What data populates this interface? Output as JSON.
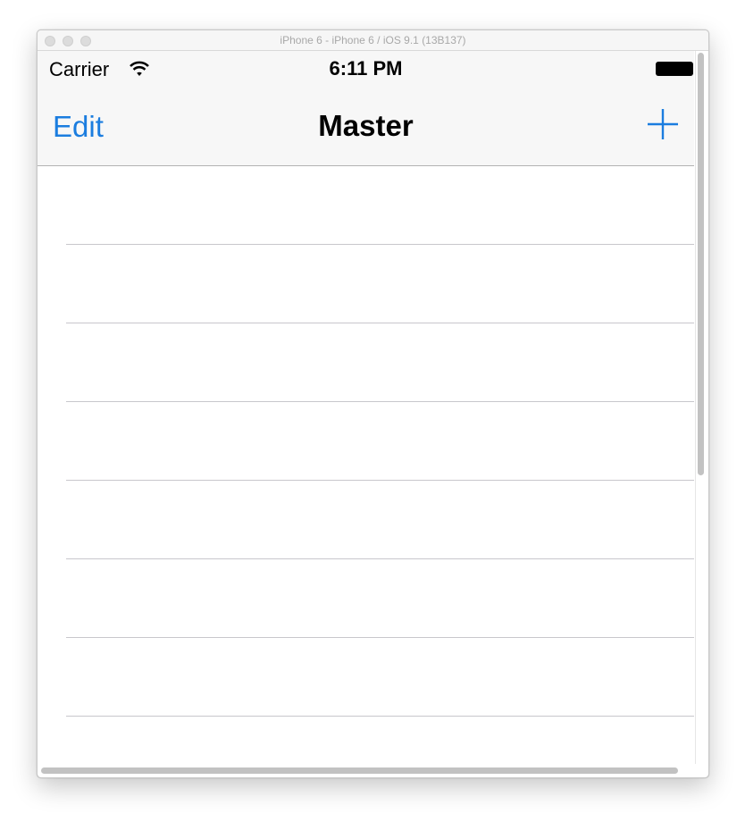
{
  "window": {
    "title": "iPhone 6 - iPhone 6 / iOS 9.1 (13B137)"
  },
  "statusbar": {
    "carrier": "Carrier",
    "time": "6:11 PM",
    "wifi_icon": "wifi-icon",
    "battery_icon": "battery-icon"
  },
  "navbar": {
    "edit_label": "Edit",
    "title": "Master",
    "add_icon": "plus-icon"
  },
  "table": {
    "rows": [
      "",
      "",
      "",
      "",
      "",
      "",
      "",
      ""
    ]
  },
  "colors": {
    "tint": "#1b7ddf",
    "bar_background": "#f7f7f7",
    "separator": "#c8c7cc"
  }
}
